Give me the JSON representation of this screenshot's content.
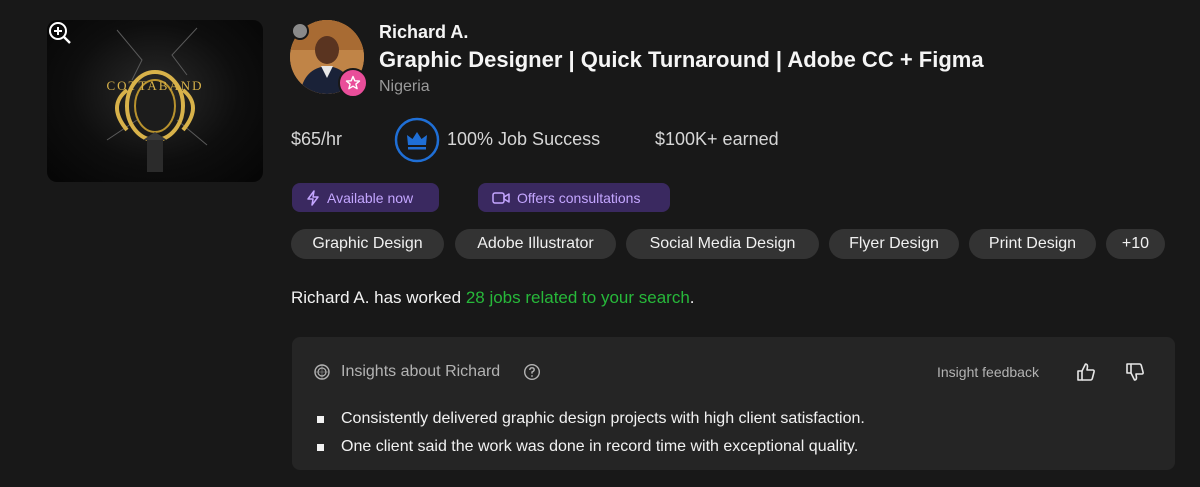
{
  "portfolio": {
    "image_text": "COTTABAND",
    "zoom_icon": "zoom-in-icon"
  },
  "profile": {
    "name": "Richard A.",
    "title": "Graphic Designer | Quick Turnaround | Adobe CC + Figma",
    "location": "Nigeria",
    "badge_icon": "star-badge-icon"
  },
  "stats": {
    "rate": "$65/hr",
    "job_success": "100% Job Success",
    "earned": "$100K+ earned",
    "jss_icon": "crown-icon"
  },
  "availability": {
    "available": "Available now",
    "consultations": "Offers consultations"
  },
  "skills": [
    "Graphic Design",
    "Adobe Illustrator",
    "Social Media Design",
    "Flyer Design",
    "Print Design",
    "+10"
  ],
  "work": {
    "prefix": "Richard A. has worked ",
    "link": "28 jobs related to your search",
    "suffix": "."
  },
  "insights": {
    "title": "Insights about Richard",
    "feedback_label": "Insight feedback",
    "items": [
      "Consistently delivered graphic design projects with high client satisfaction.",
      "One client said the work was done in record time with exceptional quality."
    ]
  },
  "colors": {
    "background": "#181818",
    "link_green": "#27b83a",
    "purple_pill": "#3a2960",
    "purple_text": "#c4a6ff",
    "badge_pink": "#e94e9a",
    "jss_blue": "#1f6fd6"
  }
}
